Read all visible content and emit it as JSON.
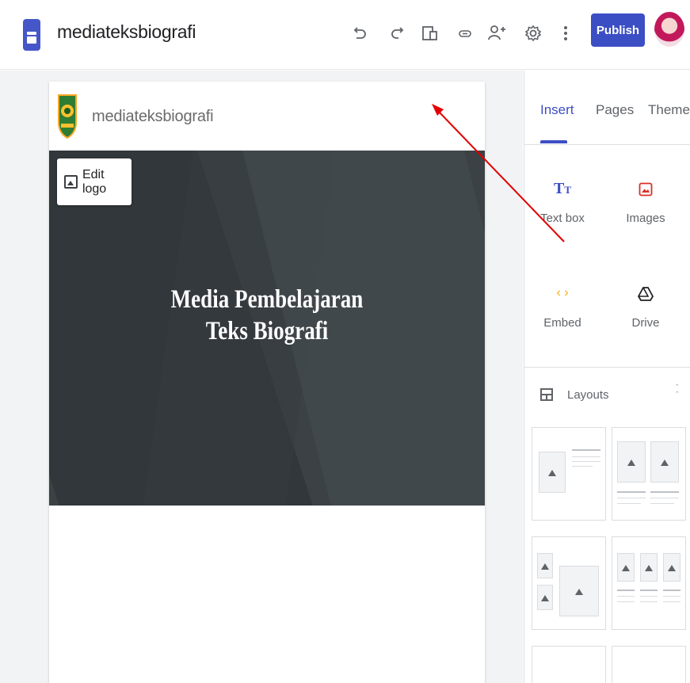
{
  "topbar": {
    "doc_title": "mediateksbiografi",
    "publish_label": "Publish",
    "icons": [
      "undo-icon",
      "redo-icon",
      "preview-icon",
      "link-icon",
      "share-icon",
      "settings-icon",
      "more-icon"
    ]
  },
  "site": {
    "name": "mediateksbiografi",
    "edit_logo_label": "Edit logo",
    "hero_title_line1": "Media Pembelajaran",
    "hero_title_line2": "Teks Biografi"
  },
  "panel": {
    "tabs": [
      {
        "label": "Insert",
        "active": true
      },
      {
        "label": "Pages",
        "active": false
      },
      {
        "label": "Themes",
        "active": false
      }
    ],
    "insert_items": [
      {
        "label": "Text box",
        "icon": "text-box-icon"
      },
      {
        "label": "Images",
        "icon": "image-icon"
      },
      {
        "label": "Embed",
        "icon": "embed-icon"
      },
      {
        "label": "Drive",
        "icon": "drive-icon"
      }
    ],
    "layouts_label": "Layouts"
  },
  "colors": {
    "accent": "#3c4ec4",
    "hero_bg": "#3b4144",
    "annotation_arrow": "#e00000"
  }
}
